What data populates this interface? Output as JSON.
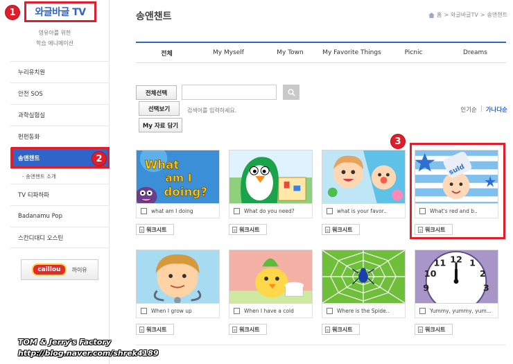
{
  "brand": {
    "title": "와글바글 TV",
    "subtitle_line1": "영유아를 위한",
    "subtitle_line2": "학습 애니메이션"
  },
  "badges": {
    "one": "1",
    "two": "2",
    "three": "3"
  },
  "sidebar": {
    "items": [
      {
        "label": "누리유치원"
      },
      {
        "label": "안전 SOS"
      },
      {
        "label": "과학실험실"
      },
      {
        "label": "펀펀동화"
      },
      {
        "label": "송앤챈트"
      },
      {
        "label": "TV 티파하파"
      },
      {
        "label": "Badanamu Pop"
      },
      {
        "label": "스칸디대디 오스틴"
      }
    ],
    "active_index": 4,
    "sub_item": "- 송앤챈트 소개",
    "caillou": {
      "logo_text": "caillou",
      "label": "까이유"
    }
  },
  "page": {
    "title": "송앤챈트",
    "breadcrumb": [
      "홈",
      ">",
      "와글바글TV",
      ">",
      "송앤챈트"
    ]
  },
  "tabs": [
    {
      "label": "전체",
      "active": true
    },
    {
      "label": "My Myself"
    },
    {
      "label": "My Town"
    },
    {
      "label": "My Favorite Things"
    },
    {
      "label": "Picnic"
    },
    {
      "label": "Dreams"
    }
  ],
  "toolbar": {
    "select_all": "전체선택",
    "view_selected": "선택보기",
    "my_save": "My 자료 담기",
    "search_placeholder": "",
    "search_hint": "검색어를 입력하세요.",
    "sort_popular": "인기순",
    "sort_sep": "|",
    "sort_alpha": "가나다순"
  },
  "worksheet_label": "워크시트",
  "videos": [
    {
      "title": "what am I doing",
      "thumb": "what-am-i-doing"
    },
    {
      "title": "What do you need?",
      "thumb": "penguin"
    },
    {
      "title": "what is your favor..",
      "thumb": "kids-cheering"
    },
    {
      "title": "What's red and b..",
      "thumb": "baby-flag"
    },
    {
      "title": "When I grow up",
      "thumb": "boy-stethoscope"
    },
    {
      "title": "When I have a cold",
      "thumb": "chick-cold"
    },
    {
      "title": "Where is the Spide..",
      "thumb": "spider-web"
    },
    {
      "title": "Yummy, yummy, yum...",
      "thumb": "clock"
    }
  ],
  "watermark": {
    "line1": "TOM & Jerry's Factory",
    "line2": "http://blog.naver.com/shrek4189"
  },
  "colors": {
    "accent": "#2f64c8",
    "highlight": "#e11d2a"
  }
}
